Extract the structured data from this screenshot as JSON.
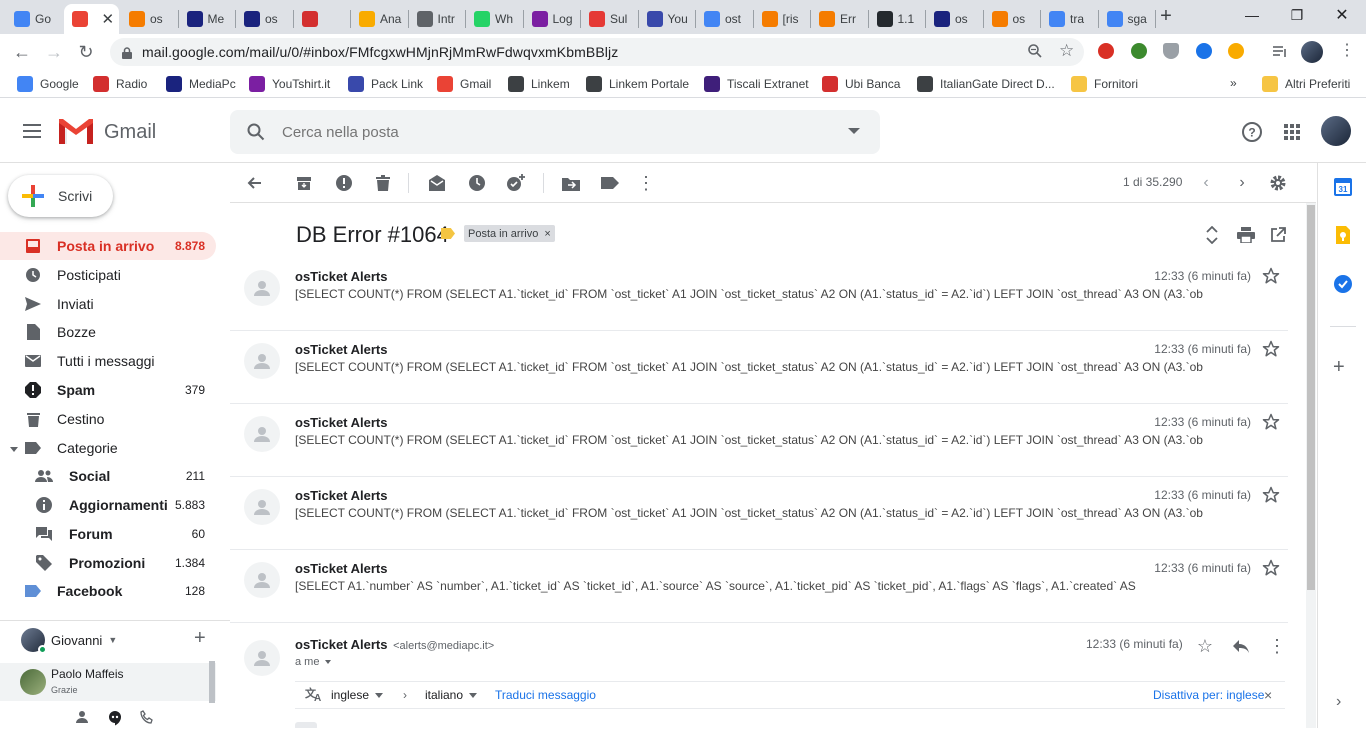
{
  "browser": {
    "tabs": [
      {
        "label": "Go",
        "icon": "google-icon",
        "color": "#4285f4"
      },
      {
        "label": "",
        "icon": "gmail-icon",
        "color": "#ea4335",
        "active": true
      },
      {
        "label": "os",
        "icon": "osticket-icon",
        "color": "#f57c00"
      },
      {
        "label": "Me",
        "icon": "mediapc-icon",
        "color": "#1a237e"
      },
      {
        "label": "os",
        "icon": "mediapc-icon",
        "color": "#1a237e"
      },
      {
        "label": "",
        "icon": "radio-icon",
        "color": "#d32f2f"
      },
      {
        "label": "Ana",
        "icon": "analytics-icon",
        "color": "#f9ab00"
      },
      {
        "label": "Intr",
        "icon": "intranet-icon",
        "color": "#5f6368"
      },
      {
        "label": "Wh",
        "icon": "whatsapp-icon",
        "color": "#25d366"
      },
      {
        "label": "Log",
        "icon": "login-icon",
        "color": "#7b1fa2"
      },
      {
        "label": "Sul",
        "icon": "sul-icon",
        "color": "#e53935"
      },
      {
        "label": "You",
        "icon": "youtube-icon",
        "color": "#3949ab"
      },
      {
        "label": "ost",
        "icon": "google-icon",
        "color": "#4285f4"
      },
      {
        "label": "[ris",
        "icon": "osticket-icon",
        "color": "#f57c00"
      },
      {
        "label": "Err",
        "icon": "osticket-icon",
        "color": "#f57c00"
      },
      {
        "label": "1.1",
        "icon": "github-icon",
        "color": "#24292e"
      },
      {
        "label": "os",
        "icon": "mediapc-icon",
        "color": "#1a237e"
      },
      {
        "label": "os",
        "icon": "osticket-icon",
        "color": "#f57c00"
      },
      {
        "label": "tra",
        "icon": "google-icon",
        "color": "#4285f4"
      },
      {
        "label": "sga",
        "icon": "google-icon",
        "color": "#4285f4"
      }
    ],
    "url": "mail.google.com/mail/u/0/#inbox/FMfcgxwHMjnRjMmRwFdwqvxmKbmBBljz",
    "bookmarks": [
      {
        "label": "Google",
        "color": "#4285f4"
      },
      {
        "label": "Radio",
        "color": "#d32f2f"
      },
      {
        "label": "MediaPc",
        "color": "#1a237e"
      },
      {
        "label": "YouTshirt.it",
        "color": "#7b1fa2"
      },
      {
        "label": "Pack Link",
        "color": "#3949ab"
      },
      {
        "label": "Gmail",
        "color": "#ea4335"
      },
      {
        "label": "Linkem",
        "color": "#3c4043"
      },
      {
        "label": "Linkem Portale",
        "color": "#3c4043"
      },
      {
        "label": "Tiscali Extranet",
        "color": "#3f1f7a"
      },
      {
        "label": "Ubi Banca",
        "color": "#d32f2f"
      },
      {
        "label": "ItalianGate Direct D...",
        "color": "#3c4043"
      },
      {
        "label": "Fornitori",
        "color": "#f6c544"
      }
    ],
    "bookmarks_more": "»",
    "other_bookmarks": "Altri Preferiti"
  },
  "gmail": {
    "app_name": "Gmail",
    "search_placeholder": "Cerca nella posta",
    "compose_label": "Scrivi",
    "nav": [
      {
        "label": "Posta in arrivo",
        "count": "8.878",
        "icon": "inbox-icon",
        "active": true
      },
      {
        "label": "Posticipati",
        "count": "",
        "icon": "clock-icon"
      },
      {
        "label": "Inviati",
        "count": "",
        "icon": "send-icon"
      },
      {
        "label": "Bozze",
        "count": "",
        "icon": "draft-icon"
      },
      {
        "label": "Tutti i messaggi",
        "count": "",
        "icon": "mail-icon"
      },
      {
        "label": "Spam",
        "count": "379",
        "icon": "spam-icon",
        "bold": true
      },
      {
        "label": "Cestino",
        "count": "",
        "icon": "trash-icon"
      },
      {
        "label": "Categorie",
        "count": "",
        "icon": "label-icon"
      },
      {
        "label": "Social",
        "count": "211",
        "icon": "people-icon",
        "bold": true,
        "sub": true
      },
      {
        "label": "Aggiornamenti",
        "count": "5.883",
        "icon": "info-icon",
        "bold": true,
        "sub": true
      },
      {
        "label": "Forum",
        "count": "60",
        "icon": "forum-icon",
        "bold": true,
        "sub": true
      },
      {
        "label": "Promozioni",
        "count": "1.384",
        "icon": "tag-icon",
        "bold": true,
        "sub": true
      },
      {
        "label": "Facebook",
        "count": "128",
        "icon": "label-icon",
        "bold": true
      }
    ],
    "hangouts": {
      "user": "Giovanni",
      "contact_name": "Paolo Maffeis",
      "contact_msg": "Grazie"
    },
    "toolbar": {
      "pager": "1 di 35.290"
    },
    "thread": {
      "subject": "DB Error #1064",
      "label": "Posta in arrivo",
      "messages": [
        {
          "sender": "osTicket Alerts",
          "time": "12:33 (6 minuti fa)",
          "snippet": "[SELECT COUNT(*) FROM (SELECT A1.`ticket_id` FROM `ost_ticket` A1 JOIN `ost_ticket_status` A2 ON (A1.`status_id` = A2.`id`) LEFT JOIN `ost_thread` A3 ON (A3.`ob"
        },
        {
          "sender": "osTicket Alerts",
          "time": "12:33 (6 minuti fa)",
          "snippet": "[SELECT COUNT(*) FROM (SELECT A1.`ticket_id` FROM `ost_ticket` A1 JOIN `ost_ticket_status` A2 ON (A1.`status_id` = A2.`id`) LEFT JOIN `ost_thread` A3 ON (A3.`ob"
        },
        {
          "sender": "osTicket Alerts",
          "time": "12:33 (6 minuti fa)",
          "snippet": "[SELECT COUNT(*) FROM (SELECT A1.`ticket_id` FROM `ost_ticket` A1 JOIN `ost_ticket_status` A2 ON (A1.`status_id` = A2.`id`) LEFT JOIN `ost_thread` A3 ON (A3.`ob"
        },
        {
          "sender": "osTicket Alerts",
          "time": "12:33 (6 minuti fa)",
          "snippet": "[SELECT COUNT(*) FROM (SELECT A1.`ticket_id` FROM `ost_ticket` A1 JOIN `ost_ticket_status` A2 ON (A1.`status_id` = A2.`id`) LEFT JOIN `ost_thread` A3 ON (A3.`ob"
        },
        {
          "sender": "osTicket Alerts",
          "time": "12:33 (6 minuti fa)",
          "snippet": "[SELECT A1.`number` AS `number`, A1.`ticket_id` AS `ticket_id`, A1.`source` AS `source`, A1.`ticket_pid` AS `ticket_pid`, A1.`flags` AS `flags`, A1.`created` AS"
        }
      ],
      "open_message": {
        "sender": "osTicket Alerts",
        "email": "<alerts@mediapc.it>",
        "to": "a me",
        "time": "12:33 (6 minuti fa)",
        "translate": {
          "from_lang": "inglese",
          "arrow": "›",
          "to_lang": "italiano",
          "translate_link": "Traduci messaggio",
          "disable_link": "Disattiva per: inglese",
          "close": "×"
        }
      }
    }
  }
}
